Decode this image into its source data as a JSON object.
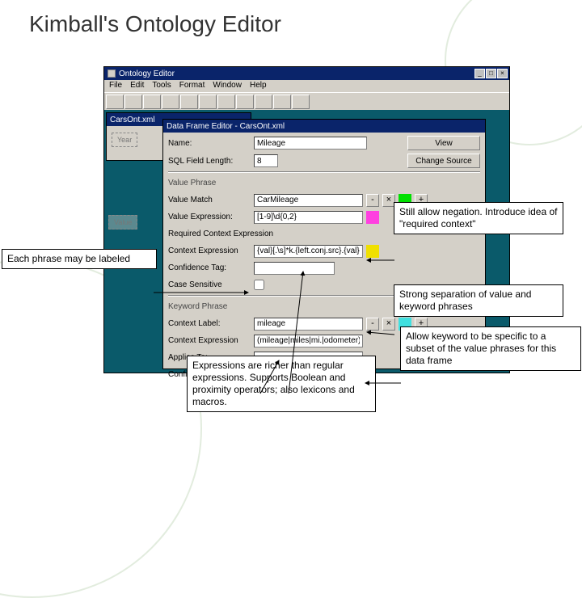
{
  "slide": {
    "title": "Kimball's Ontology Editor"
  },
  "app": {
    "title": "Ontology Editor",
    "menu": [
      "File",
      "Edit",
      "Tools",
      "Format",
      "Window",
      "Help"
    ],
    "toolbar": [
      "",
      "",
      "",
      "",
      "",
      "",
      "",
      "",
      "",
      "",
      "",
      ""
    ]
  },
  "miniwin": {
    "title": "CarsOnt.xml"
  },
  "dfe": {
    "title": "Data Frame Editor - CarsOnt.xml",
    "name_label": "Name:",
    "name_value": "Mileage",
    "view_btn": "View",
    "len_label": "SQL Field Length:",
    "len_value": "8",
    "change_btn": "Change Source",
    "section_value": "Value Phrase",
    "vm_label": "Value Match",
    "vm_value": "CarMileage",
    "ve_label": "Value Expression:",
    "ve_value": "[1-9]\\d{0,2}",
    "req_label": "Required Context Expression",
    "ce_label": "Context Expression",
    "ce_value": "{val}[.\\s]*k.{left.conj.src}.{val}",
    "cf_label": "Confidence Tag:",
    "cs_label": "Case Sensitive",
    "section_keyword": "Keyword Phrase",
    "cl_label": "Context Label:",
    "cl_value": "mileage",
    "ce2_label": "Context Expression",
    "ce2_value": "(mileage|miles|mi.|odometer)",
    "ap_label": "Applies To:",
    "ap_value": "-",
    "cf2_label": "Confidence Tag:"
  },
  "ghosts": {
    "year": "Year",
    "value": "Value"
  },
  "callouts": {
    "label": "Each phrase may be labeled",
    "neg": "Still allow negation. Introduce idea of \"required context\"",
    "sep": "Strong separation of value and keyword phrases",
    "apply": "Allow keyword to be specific to a subset of the value phrases for this data frame",
    "expr": "Expressions are richer than regular expressions.  Supports Boolean and proximity operators; also lexicons and macros."
  },
  "colors": {
    "green": "#00e000",
    "pink": "#ff40e0",
    "yellow": "#f0e000",
    "cyan": "#40e0e0"
  }
}
